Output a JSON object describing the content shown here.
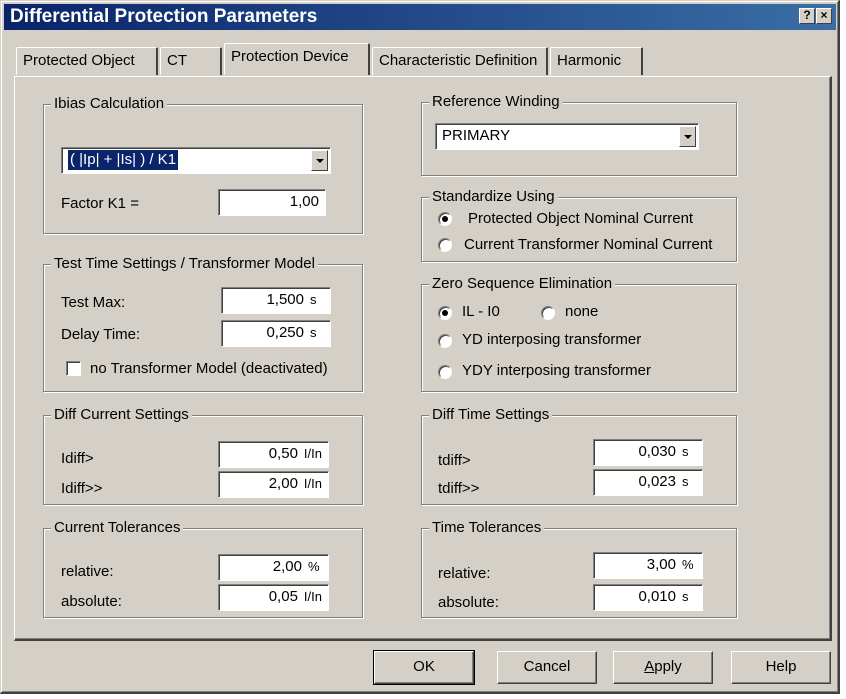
{
  "window": {
    "title": "Differential Protection Parameters",
    "help_glyph": "?",
    "close_glyph": "×"
  },
  "tabs": [
    {
      "label": "Protected Object",
      "active": false
    },
    {
      "label": "CT",
      "active": false
    },
    {
      "label": "Protection Device",
      "active": true
    },
    {
      "label": "Characteristic Definition",
      "active": false
    },
    {
      "label": "Harmonic",
      "active": false
    }
  ],
  "ibias": {
    "title": "Ibias Calculation",
    "formula": "( |Ip| + |Is| ) / K1",
    "factor_label": "Factor K1 =",
    "factor_value": "1,00"
  },
  "test_time": {
    "title": "Test Time Settings / Transformer Model",
    "test_max_label": "Test Max:",
    "test_max_value": "1,500",
    "test_max_unit": "s",
    "delay_label": "Delay Time:",
    "delay_value": "0,250",
    "delay_unit": "s",
    "no_model_label": "no  Transformer Model (deactivated)",
    "no_model_checked": false
  },
  "diff_current": {
    "title": "Diff Current Settings",
    "idiff_label": "Idiff>",
    "idiff_value": "0,50",
    "idiff_unit": "I/In",
    "idiff2_label": "Idiff>>",
    "idiff2_value": "2,00",
    "idiff2_unit": "I/In"
  },
  "current_tol": {
    "title": "Current Tolerances",
    "relative_label": "relative:",
    "relative_value": "2,00",
    "relative_unit": "%",
    "absolute_label": "absolute:",
    "absolute_value": "0,05",
    "absolute_unit": "I/In"
  },
  "ref_winding": {
    "title": "Reference Winding",
    "value": "PRIMARY"
  },
  "standardize": {
    "title": "Standardize Using",
    "options": [
      {
        "label": "Protected Object Nominal Current",
        "selected": true
      },
      {
        "label": "Current Transformer Nominal Current",
        "selected": false
      }
    ]
  },
  "zero_seq": {
    "title": "Zero Sequence Elimination",
    "opt_il": "IL - I0",
    "opt_none": "none",
    "opt_yd": "YD interposing transformer",
    "opt_ydy": "YDY interposing transformer",
    "selected": "IL - I0"
  },
  "diff_time": {
    "title": "Diff Time Settings",
    "tdiff_label": "tdiff>",
    "tdiff_value": "0,030",
    "tdiff_unit": "s",
    "tdiff2_label": "tdiff>>",
    "tdiff2_value": "0,023",
    "tdiff2_unit": "s"
  },
  "time_tol": {
    "title": "Time Tolerances",
    "relative_label": "relative:",
    "relative_value": "3,00",
    "relative_unit": "%",
    "absolute_label": "absolute:",
    "absolute_value": "0,010",
    "absolute_unit": "s"
  },
  "buttons": {
    "ok": "OK",
    "cancel": "Cancel",
    "apply_first": "A",
    "apply_rest": "pply",
    "help": "Help"
  }
}
